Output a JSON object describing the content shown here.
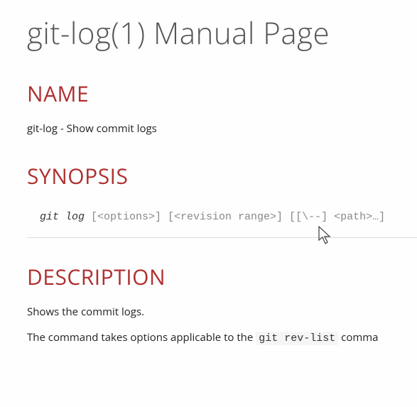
{
  "title": "git-log(1) Manual Page",
  "sections": {
    "name": {
      "heading": "NAME",
      "text": "git-log - Show commit logs"
    },
    "synopsis": {
      "heading": "SYNOPSIS",
      "cmd": "git log",
      "args": " [<options>] [<revision range>] [[\\--] <path>…​]"
    },
    "description": {
      "heading": "DESCRIPTION",
      "p1": "Shows the commit logs.",
      "p2_pre": "The command takes options applicable to the ",
      "p2_code": "git rev-list",
      "p2_post": " comma"
    }
  },
  "watermark": ""
}
